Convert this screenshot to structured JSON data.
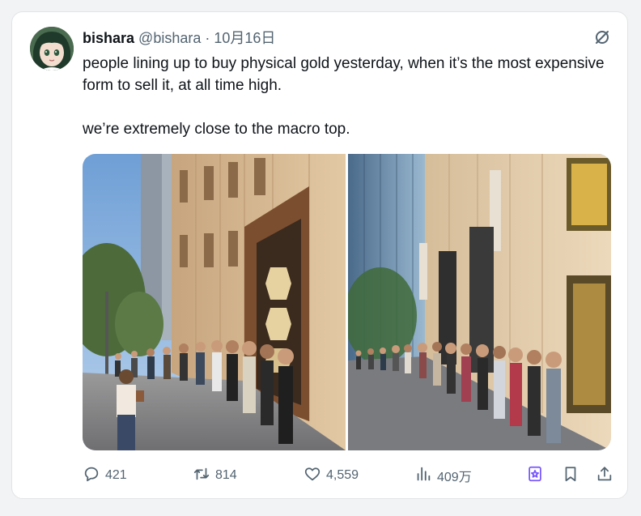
{
  "post": {
    "display_name": "bishara",
    "handle": "@bishara",
    "separator": "·",
    "date": "10月16日",
    "text_line1": "people lining up to buy physical gold yesterday, when it’s the most expensive form to sell it, at all time high.",
    "text_line2": "we’re extremely close to the macro top."
  },
  "icons": {
    "grok": "grok-slash-icon",
    "reply": "reply-bubble-icon",
    "repost": "repost-arrows-icon",
    "like": "heart-icon",
    "views": "bar-chart-icon",
    "bookmark": "bookmark-icon",
    "share": "share-upload-icon"
  },
  "metrics": {
    "replies": "421",
    "reposts": "814",
    "likes": "4,559",
    "views": "409万"
  },
  "colors": {
    "text": "#0f1419",
    "muted": "#536471",
    "accent": "#7856ff"
  }
}
